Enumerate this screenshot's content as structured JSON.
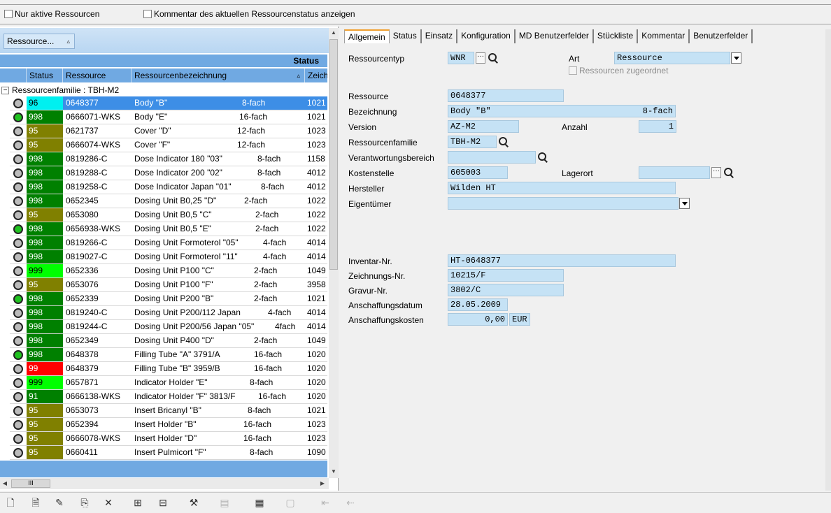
{
  "top": {
    "only_active": "Nur aktive Ressourcen",
    "comment_status": "Kommentar des aktuellen Ressourcenstatus anzeigen"
  },
  "grid": {
    "group_chip": "Ressource...",
    "status_band": "Status",
    "columns": [
      "Status",
      "Ressource",
      "Ressourcenbezeichnung",
      "Zeich"
    ],
    "family_row": "Ressourcenfamilie : TBH-M2",
    "rows": [
      {
        "led": "gray",
        "status": "96",
        "status_color": "#00f0f0",
        "res": "0648377",
        "bez": "Body \"B\"",
        "fach": "8-fach",
        "zei": "1021",
        "selected": true
      },
      {
        "led": "green",
        "status": "998",
        "status_color": "#008000",
        "res": "0666071-WKS",
        "bez": "Body \"E\"",
        "fach": "16-fach",
        "zei": "1021"
      },
      {
        "led": "gray",
        "status": "95",
        "status_color": "#808000",
        "res": "0621737",
        "bez": "Cover \"D\"",
        "fach": "12-fach",
        "zei": "1023"
      },
      {
        "led": "gray",
        "status": "95",
        "status_color": "#808000",
        "res": "0666074-WKS",
        "bez": "Cover \"F\"",
        "fach": "12-fach",
        "zei": "1023"
      },
      {
        "led": "gray",
        "status": "998",
        "status_color": "#008000",
        "res": "0819286-C",
        "bez": "Dose Indicator 180 \"03\"",
        "fach": "8-fach",
        "zei": "1158"
      },
      {
        "led": "gray",
        "status": "998",
        "status_color": "#008000",
        "res": "0819288-C",
        "bez": "Dose Indicator 200 \"02\"",
        "fach": "8-fach",
        "zei": "4012"
      },
      {
        "led": "gray",
        "status": "998",
        "status_color": "#008000",
        "res": "0819258-C",
        "bez": "Dose Indicator Japan \"01\"",
        "fach": "8-fach",
        "zei": "4012"
      },
      {
        "led": "gray",
        "status": "998",
        "status_color": "#008000",
        "res": "0652345",
        "bez": "Dosing Unit B0,25 \"D\"",
        "fach": "2-fach",
        "zei": "1022"
      },
      {
        "led": "gray",
        "status": "95",
        "status_color": "#808000",
        "res": "0653080",
        "bez": "Dosing Unit B0,5 \"C\"",
        "fach": "2-fach",
        "zei": "1022"
      },
      {
        "led": "green",
        "status": "998",
        "status_color": "#008000",
        "res": "0656938-WKS",
        "bez": "Dosing Unit B0,5 \"E\"",
        "fach": "2-fach",
        "zei": "1022"
      },
      {
        "led": "gray",
        "status": "998",
        "status_color": "#008000",
        "res": "0819266-C",
        "bez": "Dosing Unit Formoterol \"05\"",
        "fach": "4-fach",
        "zei": "4014"
      },
      {
        "led": "gray",
        "status": "998",
        "status_color": "#008000",
        "res": "0819027-C",
        "bez": "Dosing Unit Formoterol \"11\"",
        "fach": "4-fach",
        "zei": "4014"
      },
      {
        "led": "gray",
        "status": "999",
        "status_color": "#00ff00",
        "res": "0652336",
        "bez": "Dosing Unit P100 \"C\"",
        "fach": "2-fach",
        "zei": "1049"
      },
      {
        "led": "gray",
        "status": "95",
        "status_color": "#808000",
        "res": "0653076",
        "bez": "Dosing Unit P100 \"F\"",
        "fach": "2-fach",
        "zei": "3958"
      },
      {
        "led": "green",
        "status": "998",
        "status_color": "#008000",
        "res": "0652339",
        "bez": "Dosing Unit P200 \"B\"",
        "fach": "2-fach",
        "zei": "1021"
      },
      {
        "led": "gray",
        "status": "998",
        "status_color": "#008000",
        "res": "0819240-C",
        "bez": "Dosing Unit P200/112 Japan",
        "fach": "4-fach",
        "zei": "4014"
      },
      {
        "led": "gray",
        "status": "998",
        "status_color": "#008000",
        "res": "0819244-C",
        "bez": "Dosing Unit P200/56 Japan \"05\"",
        "fach": "4fach",
        "zei": "4014"
      },
      {
        "led": "gray",
        "status": "998",
        "status_color": "#008000",
        "res": "0652349",
        "bez": "Dosing Unit P400 \"D\"",
        "fach": "2-fach",
        "zei": "1049"
      },
      {
        "led": "green",
        "status": "998",
        "status_color": "#008000",
        "res": "0648378",
        "bez": "Filling Tube \"A\" 3791/A",
        "fach": "16-fach",
        "zei": "1020"
      },
      {
        "led": "gray",
        "status": "99",
        "status_color": "#ff0000",
        "res": "0648379",
        "bez": "Filling Tube \"B\" 3959/B",
        "fach": "16-fach",
        "zei": "1020"
      },
      {
        "led": "gray",
        "status": "999",
        "status_color": "#00ff00",
        "res": "0657871",
        "bez": "Indicator Holder \"E\"",
        "fach": "8-fach",
        "zei": "1020"
      },
      {
        "led": "gray",
        "status": "91",
        "status_color": "#008000",
        "res": "0666138-WKS",
        "bez": "Indicator Holder \"F\" 3813/F",
        "fach": "16-fach",
        "zei": "1020"
      },
      {
        "led": "gray",
        "status": "95",
        "status_color": "#808000",
        "res": "0653073",
        "bez": "Insert Bricanyl \"B\"",
        "fach": "8-fach",
        "zei": "1021"
      },
      {
        "led": "gray",
        "status": "95",
        "status_color": "#808000",
        "res": "0652394",
        "bez": "Insert Holder \"B\"",
        "fach": "16-fach",
        "zei": "1023"
      },
      {
        "led": "gray",
        "status": "95",
        "status_color": "#808000",
        "res": "0666078-WKS",
        "bez": "Insert Holder \"D\"",
        "fach": "16-fach",
        "zei": "1023"
      },
      {
        "led": "gray",
        "status": "95",
        "status_color": "#808000",
        "res": "0660411",
        "bez": "Insert Pulmicort \"F\"",
        "fach": "8-fach",
        "zei": "1090"
      }
    ],
    "hscroll_grip": "III"
  },
  "tabs": [
    "Allgemein",
    "Status",
    "Einsatz",
    "Konfiguration",
    "MD Benutzerfelder",
    "Stückliste",
    "Kommentar",
    "Benutzerfelder"
  ],
  "form": {
    "ressourcentyp_label": "Ressourcentyp",
    "ressourcentyp": "WNR",
    "art_label": "Art",
    "art": "Ressource",
    "zugeordnet": "Ressourcen zugeordnet",
    "ressource_label": "Ressource",
    "ressource": "0648377",
    "bezeichnung_label": "Bezeichnung",
    "bezeichnung": "Body \"B\"",
    "bezeichnung_fach": "8-fach",
    "version_label": "Version",
    "version": "AZ-M2",
    "anzahl_label": "Anzahl",
    "anzahl": "1",
    "familie_label": "Ressourcenfamilie",
    "familie": "TBH-M2",
    "verantwortung_label": "Verantwortungsbereich",
    "verantwortung": "",
    "kostenstelle_label": "Kostenstelle",
    "kostenstelle": "605003",
    "lagerort_label": "Lagerort",
    "lagerort": "",
    "hersteller_label": "Hersteller",
    "hersteller": "Wilden HT",
    "eigentuemer_label": "Eigentümer",
    "eigentuemer": "",
    "inventar_label": "Inventar-Nr.",
    "inventar": "HT-0648377",
    "zeichnung_label": "Zeichnungs-Nr.",
    "zeichnung": "10215/F",
    "gravur_label": "Gravur-Nr.",
    "gravur": "3802/C",
    "datum_label": "Anschaffungsdatum",
    "datum": "28.05.2009",
    "kosten_label": "Anschaffungskosten",
    "kosten": "0,00",
    "waehrung": "EUR",
    "dots": "···"
  },
  "toolbar_icons": [
    {
      "name": "new-icon",
      "glyph": "🗋",
      "dim": false
    },
    {
      "name": "new-copy-icon",
      "glyph": "🗎",
      "dim": false
    },
    {
      "name": "edit-icon",
      "glyph": "✎",
      "dim": false
    },
    {
      "name": "copy-icon",
      "glyph": "⎘",
      "dim": false
    },
    {
      "name": "delete-icon",
      "glyph": "✕",
      "dim": false
    },
    {
      "name": "network-add-icon",
      "glyph": "⊞",
      "dim": false
    },
    {
      "name": "network-edit-icon",
      "glyph": "⊟",
      "dim": false
    },
    {
      "name": "wrench-icon",
      "glyph": "⚒",
      "dim": false
    },
    {
      "name": "print-icon",
      "glyph": "▤",
      "dim": true
    },
    {
      "name": "report-icon",
      "glyph": "▦",
      "dim": false
    },
    {
      "name": "ne-icon",
      "glyph": "▢",
      "dim": true
    },
    {
      "name": "move-left-icon",
      "glyph": "⇤",
      "dim": true
    },
    {
      "name": "move-back-icon",
      "glyph": "⇠",
      "dim": true
    }
  ]
}
